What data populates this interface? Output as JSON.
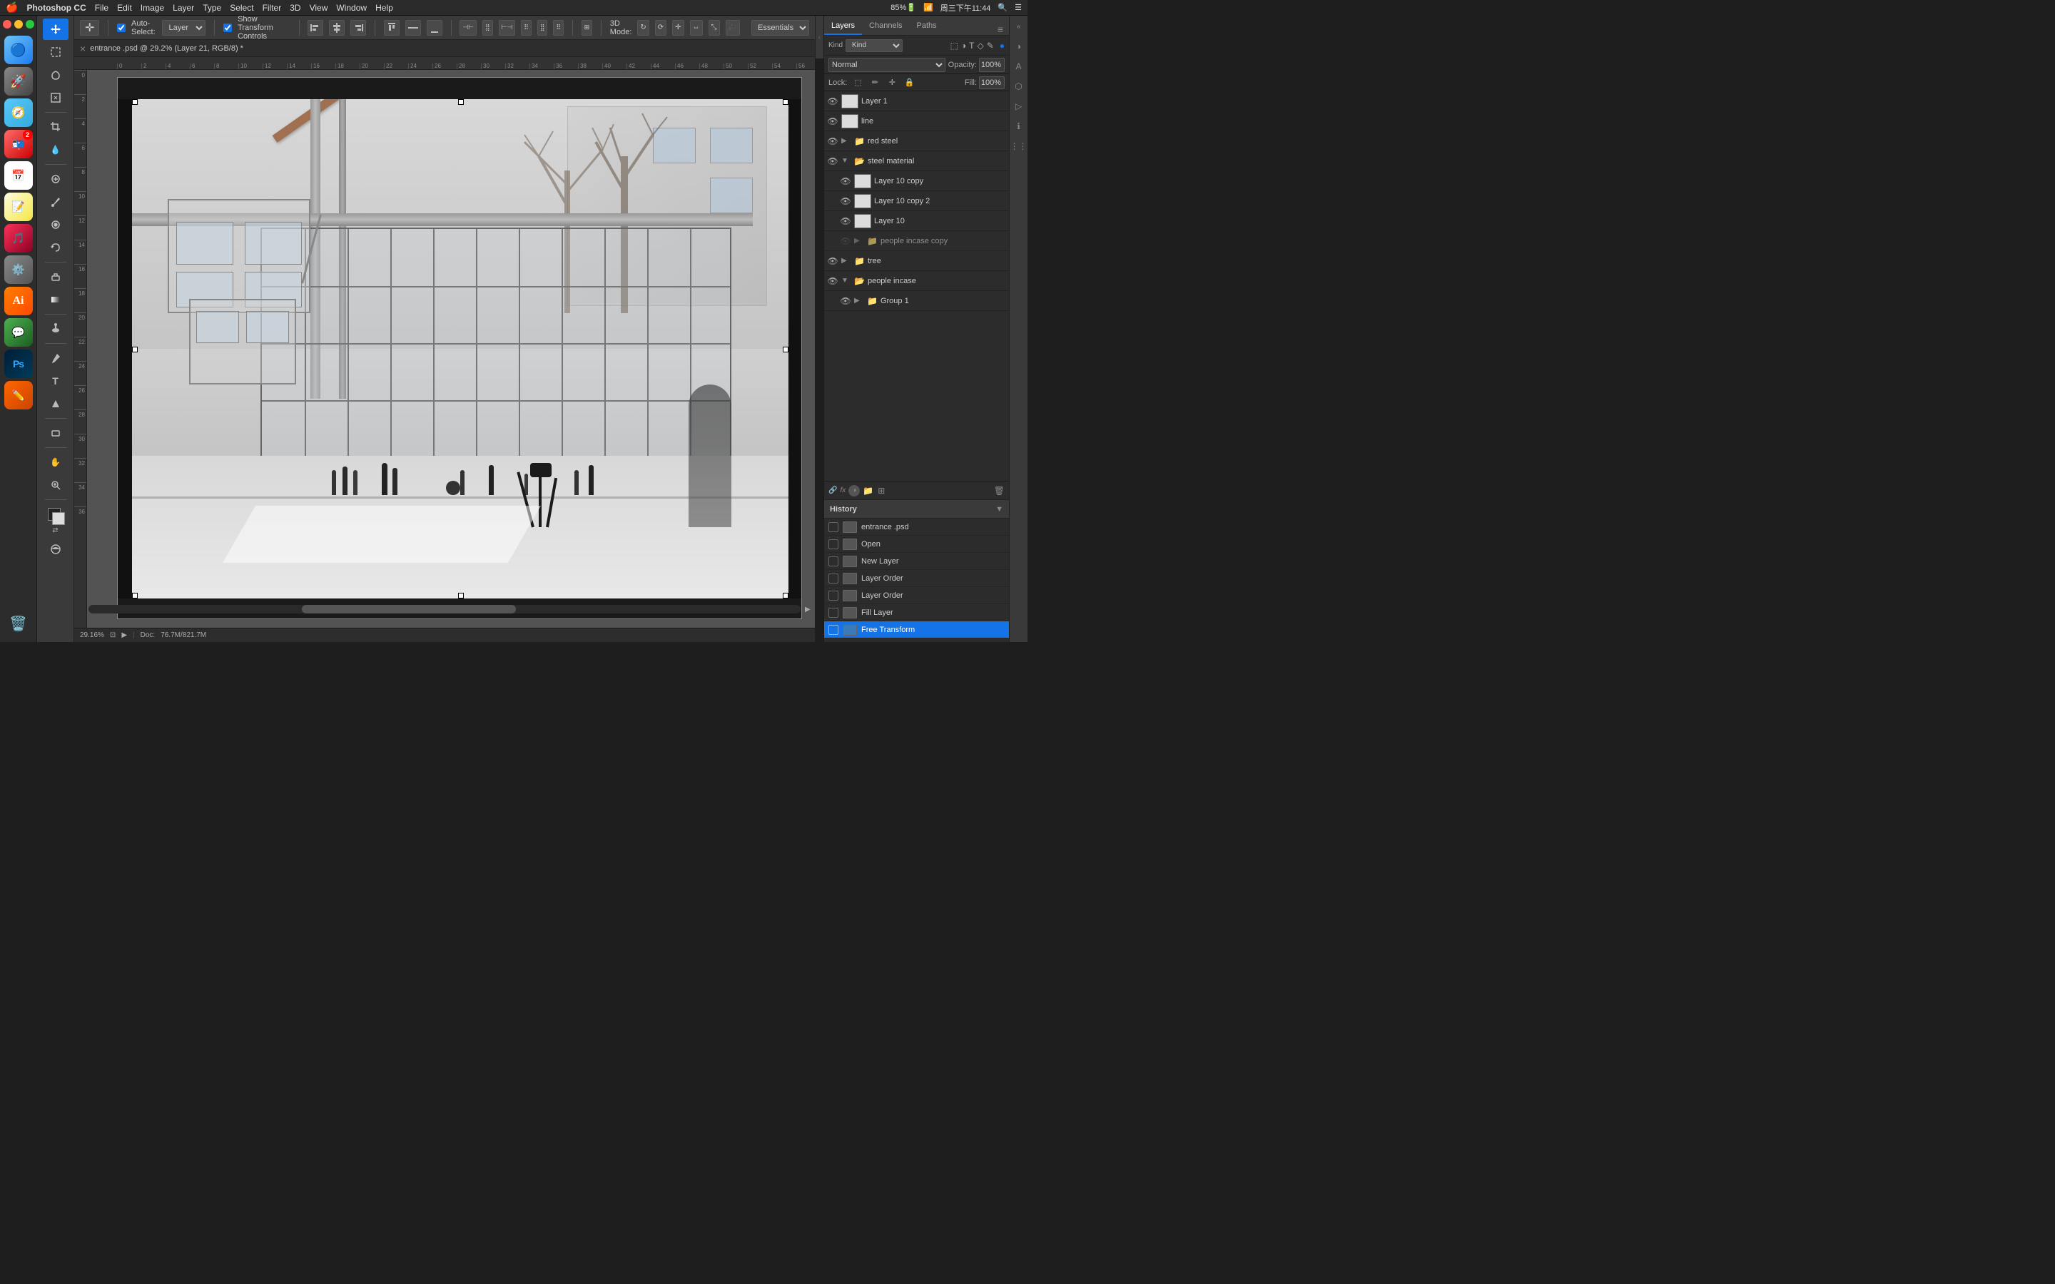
{
  "menubar": {
    "apple": "🍎",
    "photoshop": "Photoshop CC",
    "menus": [
      "File",
      "Edit",
      "Image",
      "Layer",
      "Type",
      "Select",
      "Filter",
      "3D",
      "View",
      "Window",
      "Help"
    ],
    "right_items": [
      "85%",
      "🔋",
      "📶",
      "周三下午11:44",
      "🔍",
      "☰"
    ]
  },
  "options_bar": {
    "auto_select_label": "Auto-Select:",
    "auto_select_value": "Layer",
    "show_transform": "Show Transform Controls",
    "3d_mode_label": "3D Mode:",
    "workspace": "Essentials"
  },
  "doc_tab": {
    "close_symbol": "×",
    "title": "entrance .psd @ 29.2% (Layer 21, RGB/8) *"
  },
  "canvas": {
    "zoom": "29.16%",
    "doc_size": "Doc: 76.7M/821.7M"
  },
  "layers_panel": {
    "tabs": [
      "Layers",
      "Channels",
      "Paths"
    ],
    "active_tab": "Layers",
    "filter_type": "Kind",
    "blend_mode": "Normal",
    "opacity_label": "Opacity:",
    "opacity_value": "100%",
    "lock_label": "Lock:",
    "fill_label": "Fill:",
    "fill_value": "100%",
    "layers": [
      {
        "id": 1,
        "name": "Layer 1",
        "type": "normal",
        "visible": true,
        "indent": 0,
        "thumb": "white"
      },
      {
        "id": 2,
        "name": "line",
        "type": "normal",
        "visible": true,
        "indent": 0,
        "thumb": "white"
      },
      {
        "id": 3,
        "name": "red steel",
        "type": "group",
        "visible": true,
        "indent": 0,
        "expanded": false,
        "thumb": null
      },
      {
        "id": 4,
        "name": "steel material",
        "type": "group",
        "visible": true,
        "indent": 0,
        "expanded": true,
        "thumb": null
      },
      {
        "id": 5,
        "name": "Layer 10 copy",
        "type": "normal",
        "visible": true,
        "indent": 1,
        "thumb": "white"
      },
      {
        "id": 6,
        "name": "Layer 10 copy 2",
        "type": "normal",
        "visible": true,
        "indent": 1,
        "thumb": "white"
      },
      {
        "id": 7,
        "name": "Layer 10",
        "type": "normal",
        "visible": true,
        "indent": 1,
        "thumb": "white"
      },
      {
        "id": 8,
        "name": "people incase copy",
        "type": "group",
        "visible": false,
        "indent": 1,
        "expanded": false,
        "thumb": null
      },
      {
        "id": 9,
        "name": "tree",
        "type": "group",
        "visible": true,
        "indent": 0,
        "expanded": false,
        "thumb": null
      },
      {
        "id": 10,
        "name": "people incase",
        "type": "group",
        "visible": true,
        "indent": 0,
        "expanded": false,
        "thumb": null
      },
      {
        "id": 11,
        "name": "Group 1",
        "type": "group",
        "visible": true,
        "indent": 1,
        "expanded": false,
        "thumb": null
      }
    ],
    "bottom_tools": [
      "link-icon",
      "fx-icon",
      "new-adj-icon",
      "folder-icon",
      "new-layer-icon",
      "delete-icon"
    ]
  },
  "history_panel": {
    "title": "History",
    "items": [
      {
        "id": 1,
        "name": "entrance .psd",
        "type": "file",
        "checked": false,
        "active": false
      },
      {
        "id": 2,
        "name": "Open",
        "type": "action",
        "checked": false,
        "active": false
      },
      {
        "id": 3,
        "name": "New Layer",
        "type": "action",
        "checked": false,
        "active": false
      },
      {
        "id": 4,
        "name": "Layer Order",
        "type": "action",
        "checked": false,
        "active": false
      },
      {
        "id": 5,
        "name": "Layer Order",
        "type": "action",
        "checked": false,
        "active": false
      },
      {
        "id": 6,
        "name": "Fill Layer",
        "type": "action",
        "checked": false,
        "active": false
      },
      {
        "id": 7,
        "name": "Free Transform",
        "type": "action",
        "checked": false,
        "active": true
      }
    ]
  },
  "toolbar": {
    "tools": [
      {
        "name": "move-tool",
        "icon": "move"
      },
      {
        "name": "selection-tool",
        "icon": "select"
      },
      {
        "name": "lasso-tool",
        "icon": "lasso"
      },
      {
        "name": "crop-tool",
        "icon": "crop"
      },
      {
        "name": "eyedropper-tool",
        "icon": "eyedropper"
      },
      {
        "name": "heal-tool",
        "icon": "heal"
      },
      {
        "name": "brush-tool",
        "icon": "brush"
      },
      {
        "name": "stamp-tool",
        "icon": "stamp"
      },
      {
        "name": "eraser-tool",
        "icon": "eraser"
      },
      {
        "name": "gradient-tool",
        "icon": "gradient"
      },
      {
        "name": "dodge-tool",
        "icon": "dodge"
      },
      {
        "name": "pen-tool",
        "icon": "pen"
      },
      {
        "name": "text-tool",
        "icon": "text"
      },
      {
        "name": "shape-tool",
        "icon": "shape"
      },
      {
        "name": "hand-tool",
        "icon": "hand"
      },
      {
        "name": "zoom-tool",
        "icon": "zoom"
      }
    ]
  },
  "status_bar": {
    "zoom": "29.16%",
    "arrow": "▶",
    "doc_label": "Doc:",
    "doc_size": "76.7M/821.7M"
  }
}
